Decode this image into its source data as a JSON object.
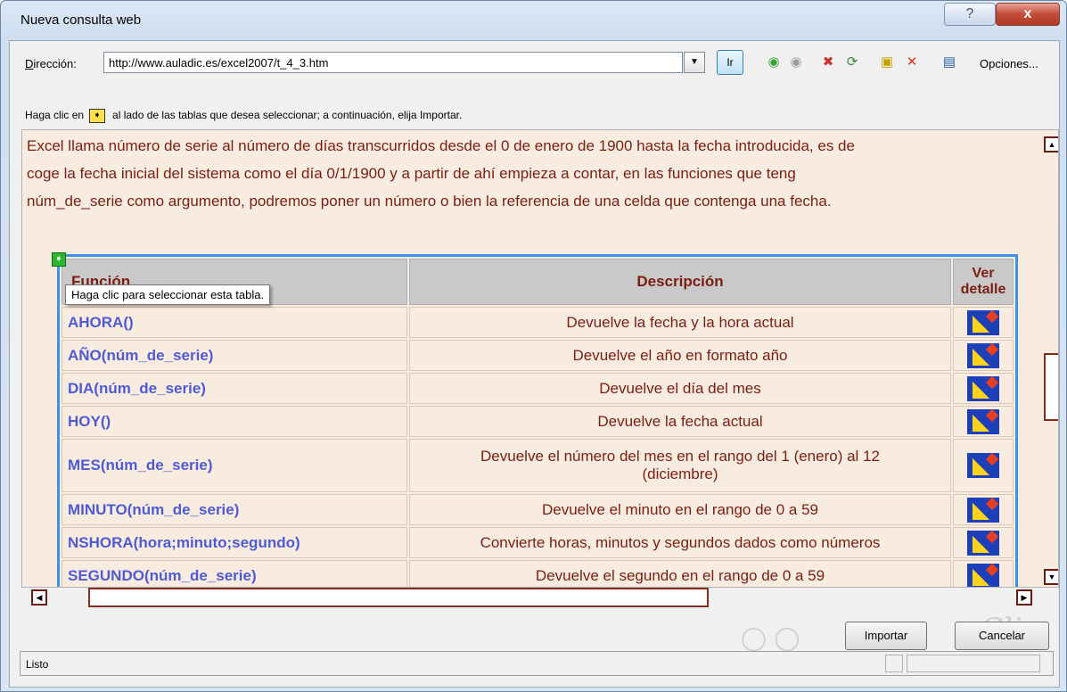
{
  "window": {
    "title": "Nueva consulta web",
    "help_label": "?",
    "close_label": "x"
  },
  "address": {
    "label_prefix": "D",
    "label_rest": "irección:",
    "url": "http://www.auladic.es/excel2007/t_4_3.htm",
    "go_label": "Ir",
    "options_label": "Opciones..."
  },
  "hint": {
    "before": "Haga clic en",
    "after": "al lado de las tablas que desea seleccionar; a continuación, elija Importar."
  },
  "page": {
    "paragraph": [
      "Excel llama número de serie al número de días transcurridos desde el 0 de enero de 1900 hasta la fecha introducida, es de",
      "coge la fecha inicial del sistema como el día 0/1/1900 y a partir de ahí empieza a contar, en las funciones que teng",
      "núm_de_serie como argumento, podremos poner un número o bien la referencia de una celda que contenga una fecha."
    ],
    "table": {
      "headers": [
        "Función",
        "Descripción",
        "Ver detalle"
      ],
      "rows": [
        {
          "fn": "AHORA()",
          "desc": "Devuelve la fecha y la hora actual"
        },
        {
          "fn": "AÑO(núm_de_serie)",
          "desc": "Devuelve el año en formato año"
        },
        {
          "fn": "DIA(núm_de_serie)",
          "desc": "Devuelve el día del mes"
        },
        {
          "fn": "HOY()",
          "desc": "Devuelve la fecha actual"
        },
        {
          "fn": "MES(núm_de_serie)",
          "desc": "Devuelve el número del mes en el rango del 1 (enero) al 12 (diciembre)"
        },
        {
          "fn": "MINUTO(núm_de_serie)",
          "desc": "Devuelve el minuto en el rango de 0 a 59"
        },
        {
          "fn": "NSHORA(hora;minuto;segundo)",
          "desc": "Convierte horas, minutos y segundos dados como números"
        },
        {
          "fn": "SEGUNDO(núm_de_serie)",
          "desc": "Devuelve el segundo en el rango de 0 a 59"
        }
      ]
    },
    "tooltip": "Haga clic para seleccionar esta tabla."
  },
  "buttons": {
    "import": "Importar",
    "cancel": "Cancelar"
  },
  "status": {
    "text": "Listo"
  },
  "colors": {
    "link_blue": "#4f5ad6",
    "text_maroon": "#7a1e12",
    "selection_blue": "#3b93e8",
    "page_bg": "#f8ece0"
  }
}
